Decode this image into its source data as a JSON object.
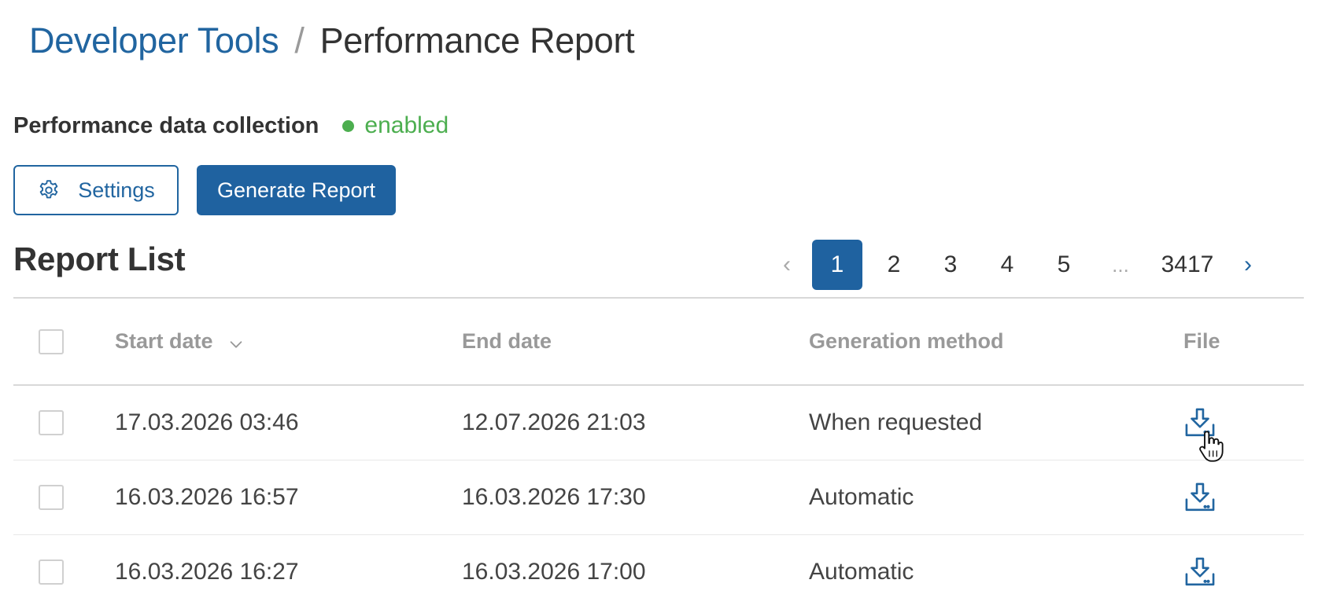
{
  "breadcrumb": {
    "parent": "Developer Tools",
    "separator": "/",
    "current": "Performance Report"
  },
  "status": {
    "label": "Performance data collection",
    "value": "enabled",
    "color": "#4cae4f"
  },
  "buttons": {
    "settings_label": "Settings",
    "settings_icon": "gear-icon",
    "generate_label": "Generate Report"
  },
  "report_list": {
    "title": "Report List"
  },
  "pagination": {
    "prev": "‹",
    "next": "›",
    "pages": [
      "1",
      "2",
      "3",
      "4",
      "5"
    ],
    "ellipsis": "...",
    "last": "3417",
    "current": "1"
  },
  "table": {
    "columns": {
      "start_date": "Start date",
      "end_date": "End date",
      "generation_method": "Generation method",
      "file": "File"
    },
    "sort_icon": "chevron-down-icon",
    "file_icon": "download-icon",
    "rows": [
      {
        "start": "17.03.2026 03:46",
        "end": "12.07.2026 21:03",
        "method": "When requested"
      },
      {
        "start": "16.03.2026 16:57",
        "end": "16.03.2026 17:30",
        "method": "Automatic"
      },
      {
        "start": "16.03.2026 16:27",
        "end": "16.03.2026 17:00",
        "method": "Automatic"
      }
    ]
  },
  "colors": {
    "accent": "#2165a0",
    "primary_button": "#1f62a0",
    "success": "#4cae4f",
    "header_text": "#999999"
  }
}
